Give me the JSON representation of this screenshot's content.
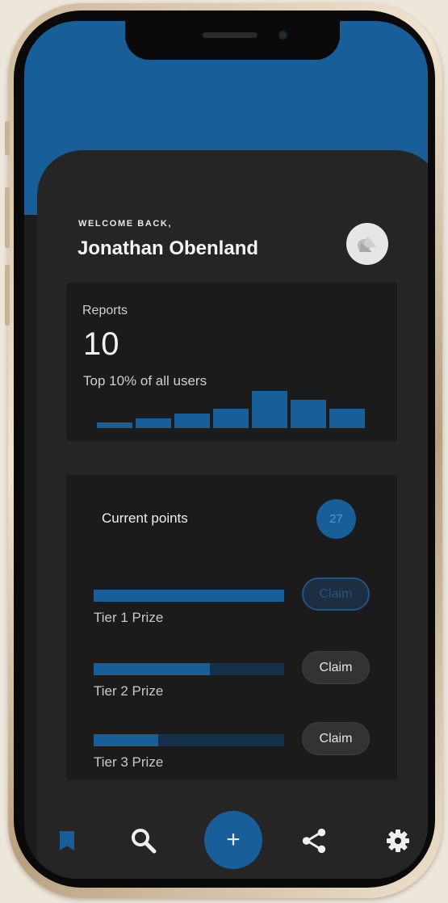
{
  "header": {
    "welcome_text": "WELCOME BACK,",
    "user_name": "Jonathan Obenland"
  },
  "reports_card": {
    "label": "Reports",
    "value": "10",
    "subtitle": "Top 10% of all users",
    "chart_data": {
      "type": "bar",
      "values": [
        6,
        10,
        15,
        20,
        38,
        29,
        20
      ]
    }
  },
  "points_card": {
    "label": "Current points",
    "points": "27",
    "tiers": [
      {
        "label": "Tier 1 Prize",
        "progress": 1.0,
        "button": "Claim",
        "active": true
      },
      {
        "label": "Tier 2 Prize",
        "progress": 0.61,
        "button": "Claim",
        "active": false
      },
      {
        "label": "Tier 3 Prize",
        "progress": 0.34,
        "button": "Claim",
        "active": false
      }
    ]
  },
  "nav": {
    "items": [
      "bookmark-icon",
      "search-icon",
      "add-icon",
      "share-icon",
      "gear-icon"
    ],
    "fab_symbol": "+"
  },
  "colors": {
    "accent": "#185f99",
    "background": "#252525",
    "card": "#1b1b1b"
  }
}
